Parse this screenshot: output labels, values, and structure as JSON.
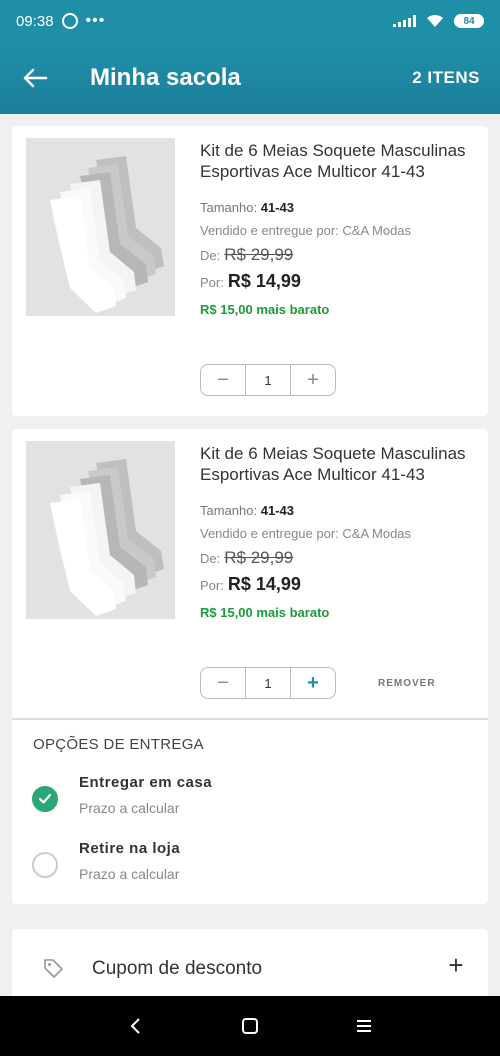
{
  "status_bar": {
    "time": "09:38",
    "battery": "84"
  },
  "header": {
    "title": "Minha sacola",
    "items_count": "2 ITENS"
  },
  "products": [
    {
      "name": "Kit de 6 Meias Soquete Masculinas Esportivas Ace Multicor 41-43",
      "size_label": "Tamanho:",
      "size_value": "41-43",
      "seller": "Vendido e entregue por: C&A Modas",
      "old_price_label": "De:",
      "old_price": "R$  29,99",
      "new_price_label": "Por:",
      "new_price": "R$  14,99",
      "saving": "R$  15,00 mais barato",
      "quantity": "1",
      "minus": "−",
      "plus": "+"
    },
    {
      "name": "Kit de 6 Meias Soquete Masculinas Esportivas Ace Multicor 41-43",
      "size_label": "Tamanho:",
      "size_value": "41-43",
      "seller": "Vendido e entregue por: C&A Modas",
      "old_price_label": "De:",
      "old_price": "R$  29,99",
      "new_price_label": "Por:",
      "new_price": "R$  14,99",
      "saving": "R$  15,00 mais barato",
      "quantity": "1",
      "minus": "−",
      "plus": "+",
      "remove_label": "REMOVER"
    }
  ],
  "delivery": {
    "title": "OPÇÕES DE ENTREGA",
    "options": [
      {
        "name": "Entregar em casa",
        "subtitle": "Prazo a calcular",
        "selected": true
      },
      {
        "name": "Retire na loja",
        "subtitle": "Prazo a calcular",
        "selected": false
      }
    ]
  },
  "coupon": {
    "label": "Cupom de desconto",
    "expand": "+"
  },
  "colors": {
    "primary": "#1f8fa8",
    "success": "#1d9a3a",
    "check": "#2aa775"
  },
  "icons": [
    "back-arrow-icon",
    "whatsapp-icon",
    "more-dots-icon",
    "signal-icon",
    "wifi-icon",
    "battery-icon",
    "check-icon",
    "tag-icon",
    "nav-back-icon",
    "nav-home-icon",
    "nav-menu-icon"
  ]
}
